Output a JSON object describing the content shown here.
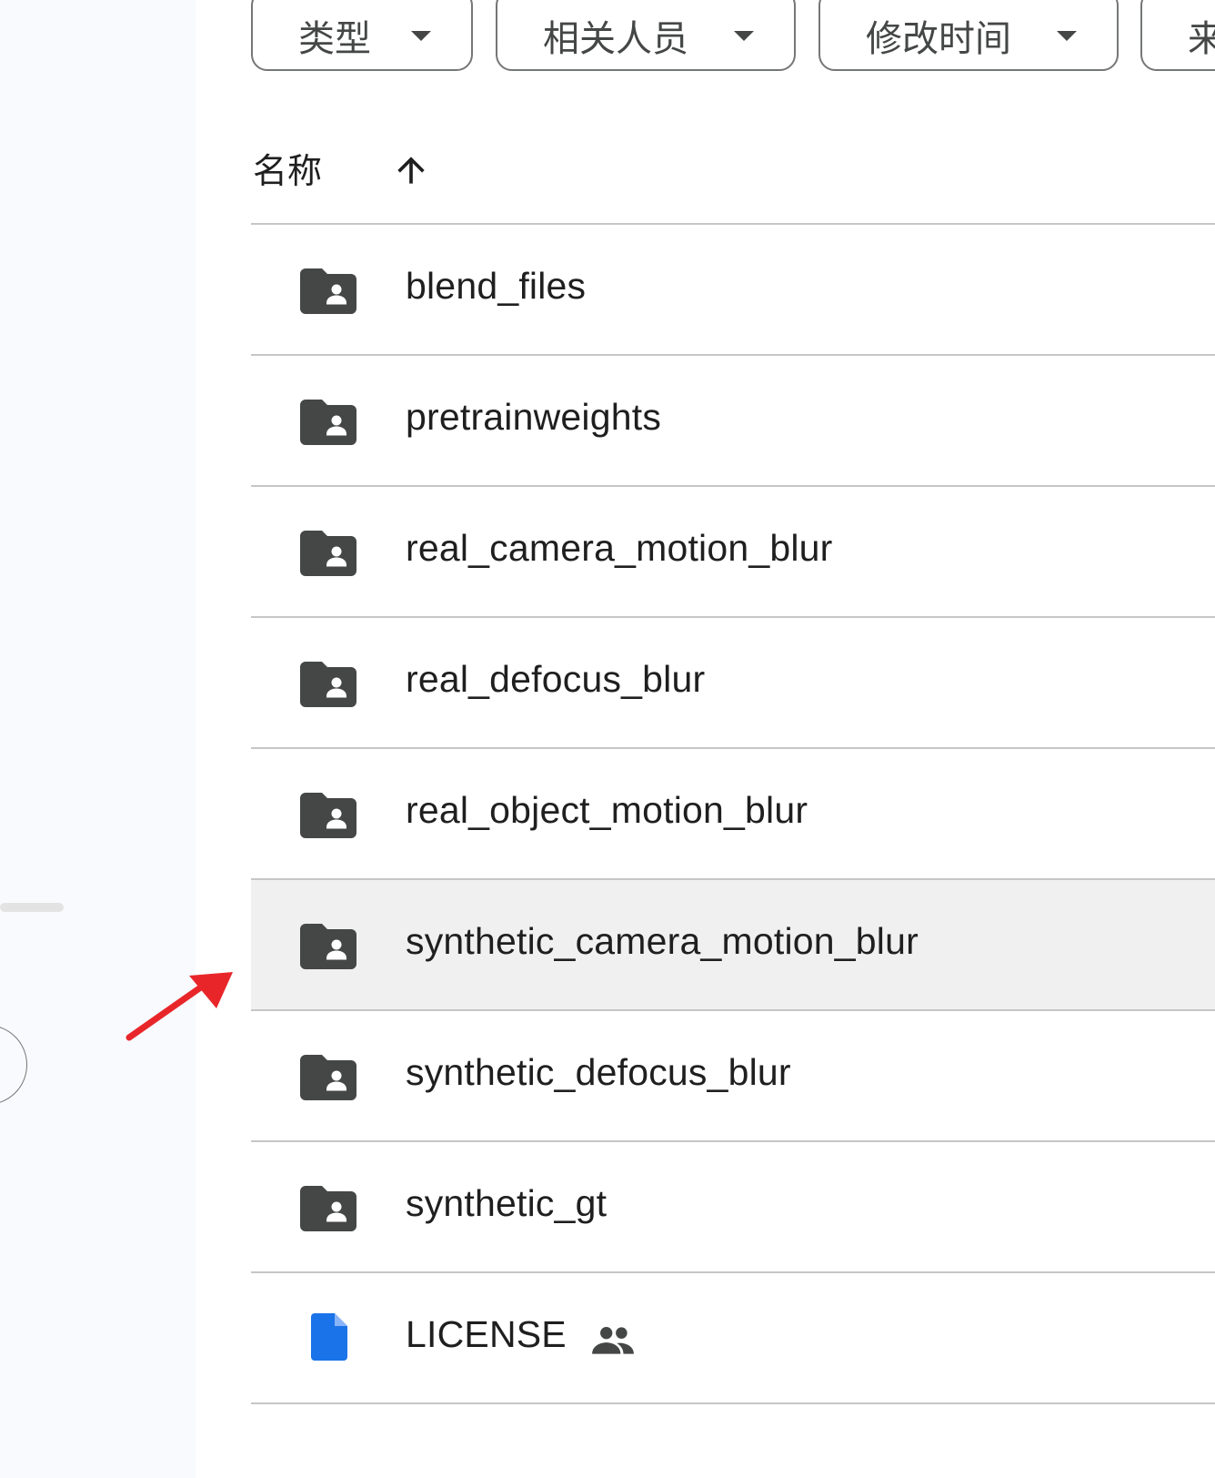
{
  "filters": {
    "type_label": "类型",
    "people_label": "相关人员",
    "modified_label": "修改时间",
    "source_label": "来"
  },
  "list_header": {
    "name_label": "名称",
    "sort_direction": "ascending"
  },
  "files": [
    {
      "name": "blend_files",
      "kind": "shared-folder",
      "selected": false
    },
    {
      "name": "pretrainweights",
      "kind": "shared-folder",
      "selected": false
    },
    {
      "name": "real_camera_motion_blur",
      "kind": "shared-folder",
      "selected": false
    },
    {
      "name": "real_defocus_blur",
      "kind": "shared-folder",
      "selected": false
    },
    {
      "name": "real_object_motion_blur",
      "kind": "shared-folder",
      "selected": false
    },
    {
      "name": "synthetic_camera_motion_blur",
      "kind": "shared-folder",
      "selected": true
    },
    {
      "name": "synthetic_defocus_blur",
      "kind": "shared-folder",
      "selected": false
    },
    {
      "name": "synthetic_gt",
      "kind": "shared-folder",
      "selected": false
    },
    {
      "name": "LICENSE",
      "kind": "document",
      "shared": true,
      "selected": false
    }
  ],
  "colors": {
    "folder_icon": "#444746",
    "document_icon": "#1a73e8",
    "selected_row": "#eff0ef",
    "annotation_arrow": "#e8262a"
  },
  "icons": {
    "sort": "arrow-up-icon",
    "folder": "shared-folder-icon",
    "document": "docs-icon",
    "shared": "people-icon",
    "chip": "dropdown-arrow-icon"
  }
}
